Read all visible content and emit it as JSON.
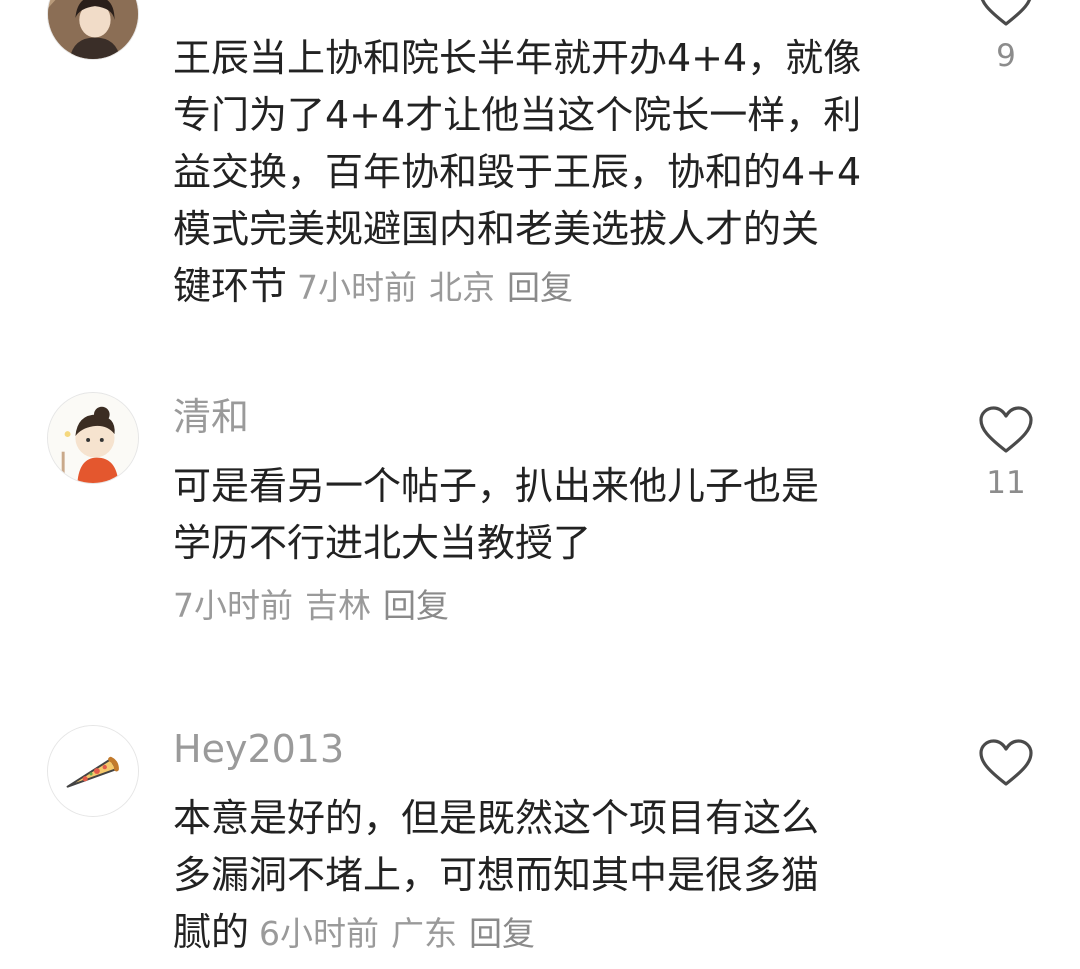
{
  "comments": [
    {
      "username": "",
      "text_lines": [
        "王辰当上协和院长半年就开办4+4，就像",
        "专门为了4+4才让他当这个院长一样，利",
        "益交换，百年协和毁于王辰，协和的4+4",
        "模式完美规避国内和老美选拔人才的关",
        "键环节"
      ],
      "time": "7小时前",
      "location": "北京",
      "reply_label": "回复",
      "like_count": "9",
      "avatar_icon": "photo-avatar-icon"
    },
    {
      "username": "清和",
      "text_lines": [
        "可是看另一个帖子，扒出来他儿子也是",
        "学历不行进北大当教授了"
      ],
      "time": "7小时前",
      "location": "吉林",
      "reply_label": "回复",
      "like_count": "11",
      "avatar_icon": "cartoon-girl-avatar-icon"
    },
    {
      "username": "Hey2013",
      "text_lines": [
        "本意是好的，但是既然这个项目有这么",
        "多漏洞不堵上，可想而知其中是很多猫",
        "腻的"
      ],
      "time": "6小时前",
      "location": "广东",
      "reply_label": "回复",
      "like_count": "",
      "avatar_icon": "pizza-avatar-icon"
    }
  ],
  "colors": {
    "text": "#222222",
    "muted": "#9a9a9a",
    "icon": "#4a4a4a"
  }
}
